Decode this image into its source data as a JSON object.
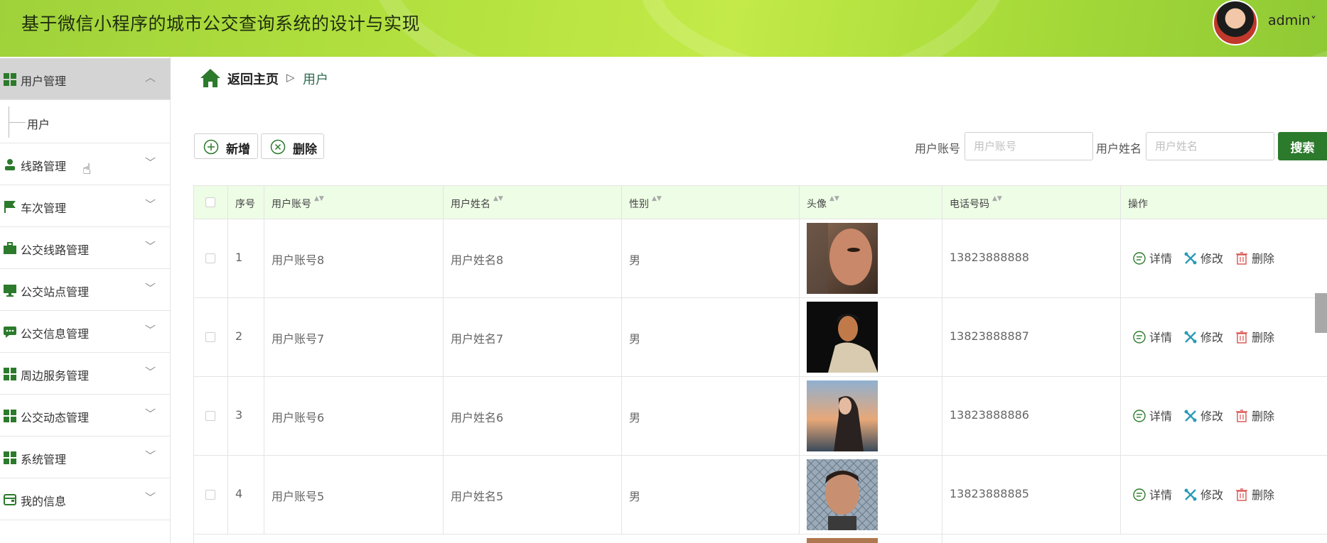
{
  "header": {
    "title": "基于微信小程序的城市公交查询系统的设计与实现",
    "username": "admin",
    "caret": "˅"
  },
  "sidebar": {
    "items": [
      {
        "label": "用户管理",
        "icon": "grid-icon",
        "chevron": "︿",
        "expanded": true,
        "children": [
          {
            "label": "用户"
          }
        ]
      },
      {
        "label": "线路管理",
        "icon": "user-icon",
        "chevron": "﹀"
      },
      {
        "label": "车次管理",
        "icon": "flag-icon",
        "chevron": "﹀"
      },
      {
        "label": "公交线路管理",
        "icon": "briefcase-icon",
        "chevron": "﹀"
      },
      {
        "label": "公交站点管理",
        "icon": "monitor-icon",
        "chevron": "﹀"
      },
      {
        "label": "公交信息管理",
        "icon": "chat-icon",
        "chevron": "﹀"
      },
      {
        "label": "周边服务管理",
        "icon": "grid-icon",
        "chevron": "﹀"
      },
      {
        "label": "公交动态管理",
        "icon": "grid-icon",
        "chevron": "﹀"
      },
      {
        "label": "系统管理",
        "icon": "grid-icon",
        "chevron": "﹀"
      },
      {
        "label": "我的信息",
        "icon": "wallet-icon",
        "chevron": "﹀"
      }
    ]
  },
  "breadcrumb": {
    "home": "返回主页",
    "separator": "▷",
    "current": "用户"
  },
  "toolbar": {
    "add_label": "新增",
    "delete_label": "删除"
  },
  "search": {
    "account_label": "用户账号",
    "account_placeholder": "用户账号",
    "account_value": "",
    "name_label": "用户姓名",
    "name_placeholder": "用户姓名",
    "name_value": "",
    "button_label": "搜索"
  },
  "table": {
    "columns": [
      "序号",
      "用户账号",
      "用户姓名",
      "性别",
      "头像",
      "电话号码",
      "操作"
    ],
    "sort_glyph": "▲▼",
    "actions": {
      "detail": "详情",
      "edit": "修改",
      "delete": "删除"
    },
    "rows": [
      {
        "index": "1",
        "account": "用户账号8",
        "name": "用户姓名8",
        "gender": "男",
        "phone": "13823888888"
      },
      {
        "index": "2",
        "account": "用户账号7",
        "name": "用户姓名7",
        "gender": "男",
        "phone": "13823888887"
      },
      {
        "index": "3",
        "account": "用户账号6",
        "name": "用户姓名6",
        "gender": "男",
        "phone": "13823888886"
      },
      {
        "index": "4",
        "account": "用户账号5",
        "name": "用户姓名5",
        "gender": "男",
        "phone": "13823888885"
      }
    ]
  },
  "colors": {
    "primary": "#2c7a2c",
    "header_green": "#b5e23f",
    "table_header": "#eefde6"
  }
}
